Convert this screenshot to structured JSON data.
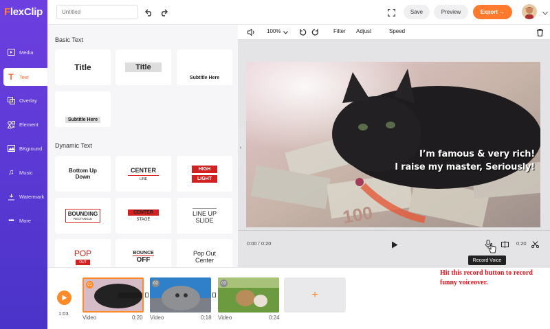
{
  "app": {
    "logo_prefix": "F",
    "logo_rest": "lexClip"
  },
  "sidebar": {
    "items": [
      {
        "label": "Media",
        "icon": "media-icon"
      },
      {
        "label": "Text",
        "icon": "text-icon"
      },
      {
        "label": "Overlay",
        "icon": "overlay-icon"
      },
      {
        "label": "Element",
        "icon": "element-icon"
      },
      {
        "label": "BKground",
        "icon": "background-icon"
      },
      {
        "label": "Music",
        "icon": "music-icon"
      },
      {
        "label": "Watermark",
        "icon": "watermark-icon"
      },
      {
        "label": "More",
        "icon": "more-icon"
      }
    ],
    "active": "Text"
  },
  "topbar": {
    "title_placeholder": "Untitled",
    "save_label": "Save",
    "preview_label": "Preview",
    "export_label": "Export →"
  },
  "panel": {
    "basic_heading": "Basic Text",
    "dynamic_heading": "Dynamic Text",
    "basic": [
      {
        "text": "Title"
      },
      {
        "text": "Title"
      },
      {
        "text": "Subtitle Here"
      },
      {
        "text": "Subtitle Here"
      }
    ],
    "dynamic": [
      {
        "line1": "Bottom Up",
        "line2": "Down"
      },
      {
        "line1": "CENTER",
        "line2": "LINE"
      },
      {
        "line1": "HIGH",
        "line2": "LIGHT"
      },
      {
        "line1": "BOUNDING",
        "line2": "RECTANGLE"
      },
      {
        "line1": "CENTER",
        "line2": "STAGE"
      },
      {
        "line1": "LINE UP",
        "line2": "SLIDE"
      },
      {
        "line1": "POP",
        "line2": "OUT"
      },
      {
        "line1": "BOUNCE",
        "line2": "OFF"
      },
      {
        "line1": "Pop Out",
        "line2": "Center"
      }
    ]
  },
  "editor_toolbar": {
    "zoom": "100%",
    "filter": "Filter",
    "adjust": "Adjust",
    "speed": "Speed"
  },
  "canvas": {
    "caption_line1": "I’m famous & very rich!",
    "caption_line2": "I raise my master, Seriously!"
  },
  "controls": {
    "time": "0:00 / 0:20",
    "duration": "0:20",
    "tooltip": "Record Voice"
  },
  "timeline": {
    "total": "1:03",
    "clips": [
      {
        "num": "01",
        "type": "Video",
        "duration": "0:20"
      },
      {
        "num": "02",
        "type": "Video",
        "duration": "0:18"
      },
      {
        "num": "03",
        "type": "Video",
        "duration": "0:24"
      }
    ]
  },
  "note": "Hit this record button to record funny voiceover.",
  "colors": {
    "accent": "#ff7a2c",
    "sidebar": "#5a37d4",
    "note": "#e3121c"
  }
}
